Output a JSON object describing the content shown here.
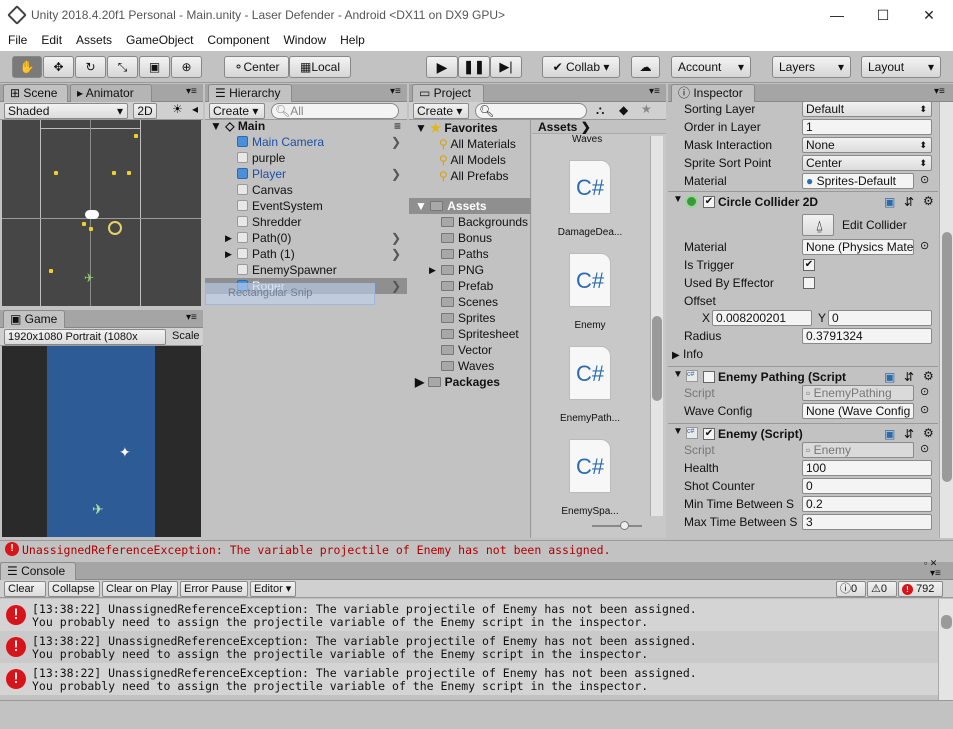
{
  "window": {
    "title": "Unity 2018.4.20f1 Personal - Main.unity - Laser Defender - Android <DX11 on DX9 GPU>"
  },
  "menu": [
    "File",
    "Edit",
    "Assets",
    "GameObject",
    "Component",
    "Window",
    "Help"
  ],
  "toolbar": {
    "center": "Center",
    "local": "Local",
    "collab": "Collab ▾",
    "account": "Account",
    "layers": "Layers",
    "layout": "Layout"
  },
  "scene": {
    "tab_scene": "Scene",
    "tab_animator": "Animator",
    "shading": "Shaded",
    "mode2d": "2D"
  },
  "game": {
    "tab": "Game",
    "resolution": "1920x1080 Portrait (1080x",
    "scale": "Scale"
  },
  "hierarchy": {
    "tab": "Hierarchy",
    "create": "Create",
    "search_placeholder": "All",
    "scene": "Main",
    "items": [
      {
        "name": "Main Camera",
        "icon": "blue",
        "arrow": "right",
        "expand": false
      },
      {
        "name": "purple",
        "icon": "grey",
        "arrow": "",
        "expand": false
      },
      {
        "name": "Player",
        "icon": "blue",
        "arrow": "right",
        "expand": false
      },
      {
        "name": "Canvas",
        "icon": "grey",
        "arrow": "",
        "expand": false
      },
      {
        "name": "EventSystem",
        "icon": "grey",
        "arrow": "",
        "expand": false
      },
      {
        "name": "Shredder",
        "icon": "grey",
        "arrow": "",
        "expand": false
      },
      {
        "name": "Path(0)",
        "icon": "grey",
        "arrow": "right",
        "expand": true
      },
      {
        "name": "Path (1)",
        "icon": "grey",
        "arrow": "right",
        "expand": true
      },
      {
        "name": "EnemySpawner",
        "icon": "grey",
        "arrow": "",
        "expand": false
      },
      {
        "name": "Roger",
        "icon": "blue",
        "arrow": "right",
        "expand": false
      }
    ],
    "snip_overlay": "Rectangular Snip"
  },
  "project": {
    "tab": "Project",
    "create": "Create",
    "favorites": "Favorites",
    "fav_items": [
      "All Materials",
      "All Models",
      "All Prefabs"
    ],
    "assets": "Assets",
    "folders": [
      "Backgrounds",
      "Bonus",
      "Paths",
      "PNG",
      "Prefab",
      "Scenes",
      "Sprites",
      "Spritesheet",
      "Vector",
      "Waves"
    ],
    "packages": "Packages",
    "breadcrumb": "Assets",
    "files": [
      {
        "label": "Waves"
      },
      {
        "label": "DamageDea..."
      },
      {
        "label": "Enemy"
      },
      {
        "label": "EnemyPath..."
      },
      {
        "label": "EnemySpa..."
      }
    ],
    "cs_glyph": "C#"
  },
  "inspector": {
    "tab": "Inspector",
    "renderer": [
      {
        "label": "Sorting Layer",
        "value": "Default",
        "type": "drop"
      },
      {
        "label": "Order in Layer",
        "value": "1",
        "type": "field"
      },
      {
        "label": "Mask Interaction",
        "value": "None",
        "type": "drop"
      },
      {
        "label": "Sprite Sort Point",
        "value": "Center",
        "type": "drop"
      },
      {
        "label": "Material",
        "value": "Sprites-Default",
        "type": "obj"
      }
    ],
    "collider": {
      "title": "Circle Collider 2D",
      "edit": "Edit Collider",
      "material_label": "Material",
      "material": "None (Physics Mate",
      "trigger": "Is Trigger",
      "effector": "Used By Effector",
      "offset": "Offset",
      "x_label": "X",
      "x": "0.008200201",
      "y_label": "Y",
      "y": "0",
      "radius_label": "Radius",
      "radius": "0.3791324",
      "info": "Info"
    },
    "pathing": {
      "title": "Enemy Pathing (Script",
      "script_label": "Script",
      "script": "EnemyPathing",
      "wave_label": "Wave Config",
      "wave": "None (Wave Config"
    },
    "enemy": {
      "title": "Enemy (Script)",
      "script_label": "Script",
      "script": "Enemy",
      "fields": [
        {
          "label": "Health",
          "value": "100"
        },
        {
          "label": "Shot Counter",
          "value": "0"
        },
        {
          "label": "Min Time Between S",
          "value": "0.2"
        },
        {
          "label": "Max Time Between S",
          "value": "3"
        }
      ]
    }
  },
  "statusbar": "UnassignedReferenceException: The variable projectile of Enemy has not been assigned.",
  "console": {
    "tab": "Console",
    "buttons": [
      "Clear",
      "Collapse",
      "Clear on Play",
      "Error Pause",
      "Editor ▾"
    ],
    "info_count": "0",
    "warn_count": "0",
    "error_count": "792",
    "rows": [
      {
        "line1": "[13:38:22] UnassignedReferenceException: The variable projectile of Enemy has not been assigned.",
        "line2": "You probably need to assign the projectile variable of the Enemy script in the inspector."
      },
      {
        "line1": "[13:38:22] UnassignedReferenceException: The variable projectile of Enemy has not been assigned.",
        "line2": "You probably need to assign the projectile variable of the Enemy script in the inspector."
      },
      {
        "line1": "[13:38:22] UnassignedReferenceException: The variable projectile of Enemy has not been assigned.",
        "line2": "You probably need to assign the projectile variable of the Enemy script in the inspector."
      }
    ]
  }
}
